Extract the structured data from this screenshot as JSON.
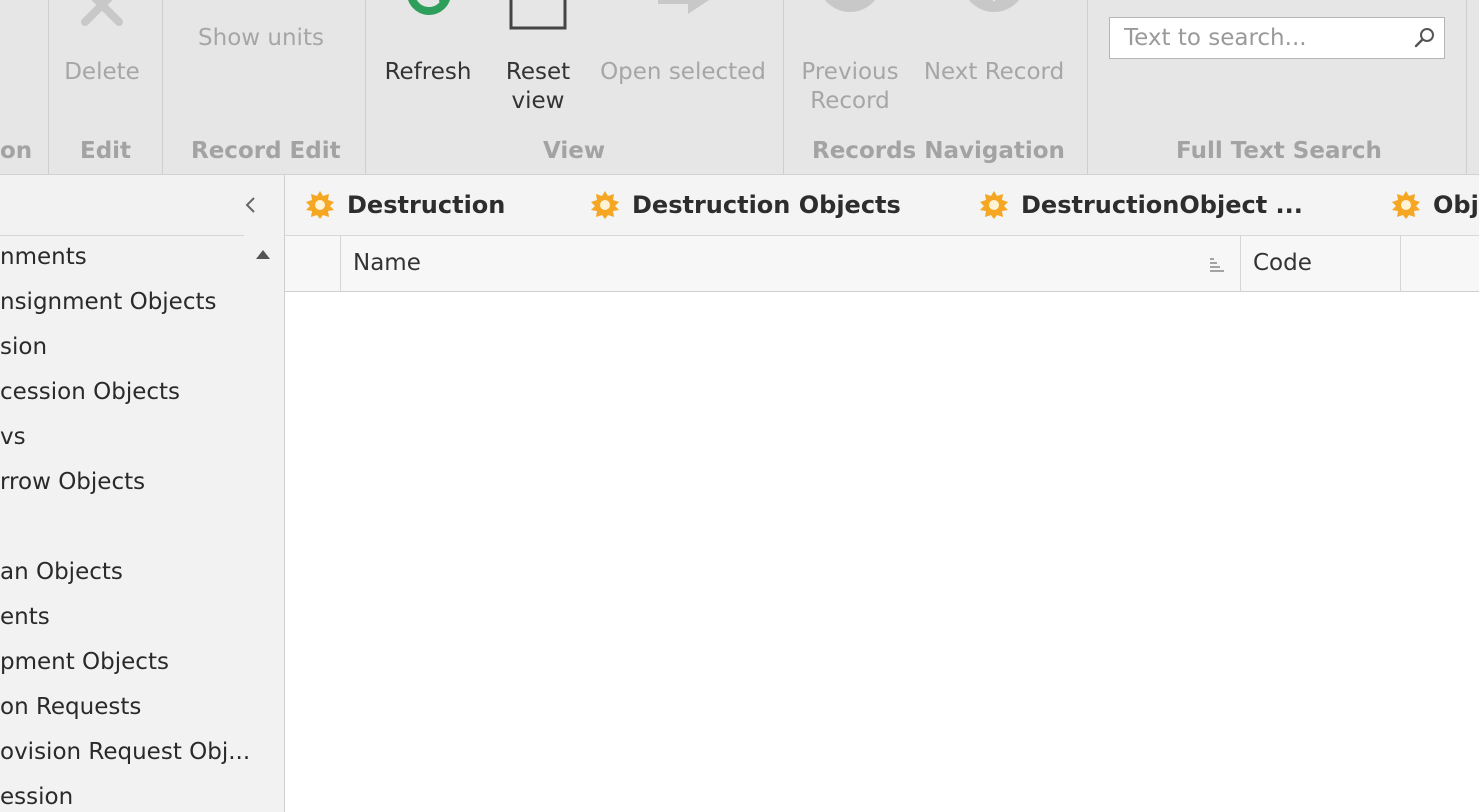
{
  "ribbon": {
    "groups": {
      "partial_label": "on",
      "edit": "Edit",
      "record_edit": "Record Edit",
      "view": "View",
      "records_navigation": "Records Navigation",
      "full_text_search": "Full Text Search"
    },
    "buttons": {
      "delete": "Delete",
      "show_units": "Show units",
      "refresh": "Refresh",
      "reset_view_line1": "Reset",
      "reset_view_line2": "view",
      "open_selected": "Open selected",
      "previous_record_line1": "Previous",
      "previous_record_line2": "Record",
      "next_record": "Next Record"
    },
    "search": {
      "placeholder": "Text to search...",
      "value": ""
    }
  },
  "nav": {
    "items": [
      "nments",
      "nsignment Objects",
      "sion",
      "cession Objects",
      "vs",
      "rrow Objects",
      "",
      "an Objects",
      "ents",
      "pment Objects",
      "on Requests",
      "ovision Request Obj...",
      "ession"
    ]
  },
  "tabs": [
    "Destruction",
    "Destruction Objects",
    "DestructionObject ...",
    "Obj"
  ],
  "grid": {
    "columns": [
      "Name",
      "Code"
    ],
    "rows": []
  },
  "icons": {
    "delete": "close-x-icon",
    "refresh": "refresh-icon",
    "reset_view": "reset-view-icon",
    "open_selected": "arrow-right-icon",
    "previous_record": "arrow-up-circle-icon",
    "next_record": "arrow-down-circle-icon",
    "search": "magnifier-icon",
    "tab": "gear-badge-icon"
  },
  "colors": {
    "accent_tab_icon": "#f5a623",
    "refresh_icon": "#2e9e5b"
  }
}
